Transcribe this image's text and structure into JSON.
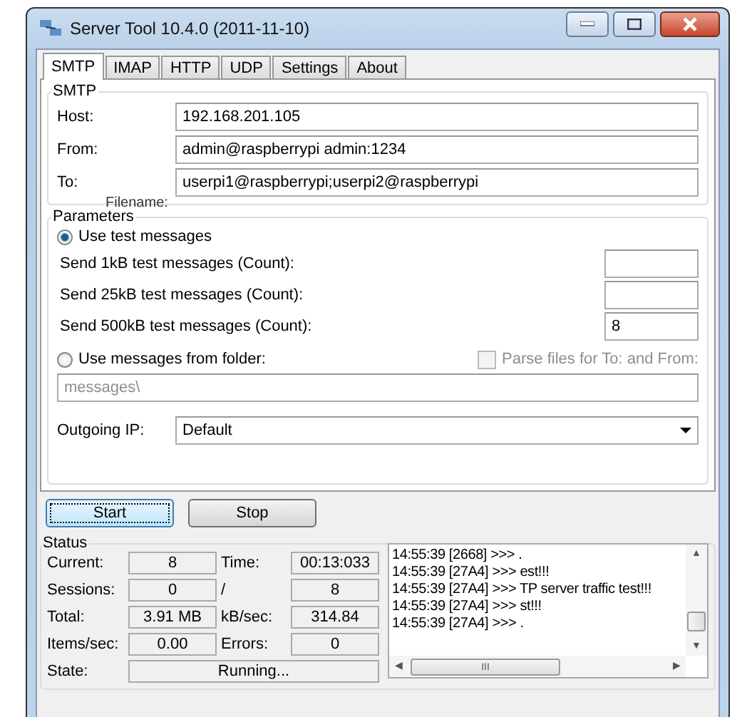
{
  "window": {
    "title": "Server Tool 10.4.0 (2011-11-10)"
  },
  "tabs": [
    {
      "label": "SMTP",
      "selected": true
    },
    {
      "label": "IMAP",
      "selected": false
    },
    {
      "label": "HTTP",
      "selected": false
    },
    {
      "label": "UDP",
      "selected": false
    },
    {
      "label": "Settings",
      "selected": false
    },
    {
      "label": "About",
      "selected": false
    }
  ],
  "smtp": {
    "title": "SMTP",
    "fields": [
      {
        "label": "Host:",
        "value": "192.168.201.105"
      },
      {
        "label": "From:",
        "value": "admin@raspberrypi admin:1234"
      },
      {
        "label": "To:",
        "value": "userpi1@raspberrypi;userpi2@raspberrypi"
      }
    ],
    "ghost_label": "Filename:"
  },
  "parameters": {
    "title": "Parameters",
    "use_test": {
      "label": "Use test messages",
      "selected": true
    },
    "counts": [
      {
        "label": "Send 1kB test messages (Count):"
      },
      {
        "label": "Send 25kB test messages (Count):"
      },
      {
        "label": "Send 500kB test messages (Count):",
        "value": "8"
      }
    ],
    "use_folder": {
      "label": "Use messages from folder:",
      "selected": false
    },
    "parse_files": {
      "label": "Parse files for To: and From:",
      "checked": false,
      "disabled": true
    },
    "folder": {
      "value": "messages\\",
      "disabled": true
    },
    "outgoing_ip": {
      "label": "Outgoing IP:",
      "value": "Default"
    }
  },
  "buttons": [
    {
      "label": "Start",
      "focused": true
    },
    {
      "label": "Stop",
      "focused": false
    }
  ],
  "status": {
    "title": "Status",
    "rows": [
      {
        "label": "Current:",
        "value": "8",
        "label2": "Time:",
        "value2": "00:13:033"
      },
      {
        "label": "Sessions:",
        "value": "0",
        "label2": "/",
        "value2": "8"
      },
      {
        "label": "Total:",
        "value": "3.91 MB",
        "label2": "kB/sec:",
        "value2": "314.84"
      },
      {
        "label": "Items/sec:",
        "value": "0.00",
        "label2": "Errors:",
        "value2": "0"
      }
    ],
    "state": {
      "label": "State:",
      "value": "Running..."
    },
    "log": [
      "14:55:39 [2668] >>> .",
      "14:55:39 [27A4] >>> est!!!",
      "14:55:39 [27A4] >>> TP server traffic test!!!",
      "14:55:39 [27A4] >>> st!!!",
      "14:55:39 [27A4] >>> ."
    ],
    "scroll_glyphs": {
      "up": "▲",
      "down": "▼",
      "left": "◀",
      "right": "▶",
      "grip": "III"
    }
  }
}
